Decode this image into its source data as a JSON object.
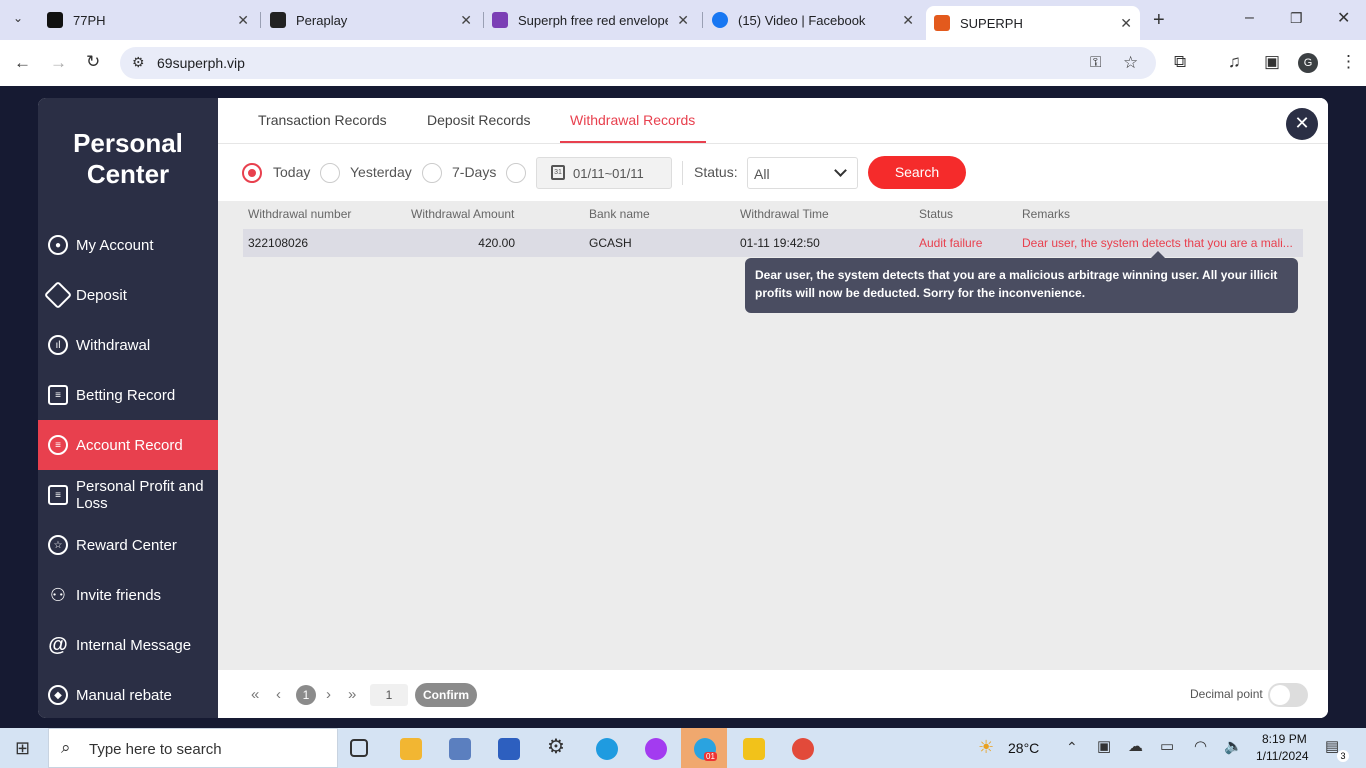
{
  "browser": {
    "tabs": [
      {
        "title": "77PH",
        "color": "#111"
      },
      {
        "title": "Peraplay",
        "color": "#222"
      },
      {
        "title": "Superph free red envelope f",
        "color": "#7b3fb5"
      },
      {
        "title": "(15) Video | Facebook",
        "color": "#1877f2"
      },
      {
        "title": "SUPERPH",
        "color": "#e35a1d"
      }
    ],
    "url": "69superph.vip"
  },
  "sidebar": {
    "title": "Personal Center",
    "items": [
      {
        "label": "My Account",
        "icon": "user-icon"
      },
      {
        "label": "Deposit",
        "icon": "tag-icon"
      },
      {
        "label": "Withdrawal",
        "icon": "chart-icon"
      },
      {
        "label": "Betting Record",
        "icon": "clipboard-icon"
      },
      {
        "label": "Account Record",
        "icon": "list-icon"
      },
      {
        "label": "Personal Profit and Loss",
        "icon": "document-icon"
      },
      {
        "label": "Reward Center",
        "icon": "star-icon"
      },
      {
        "label": "Invite friends",
        "icon": "people-icon"
      },
      {
        "label": "Internal Message",
        "icon": "at-icon"
      },
      {
        "label": "Manual rebate",
        "icon": "rebate-icon"
      }
    ],
    "active": "Account Record"
  },
  "record_tabs": [
    "Transaction Records",
    "Deposit Records",
    "Withdrawal Records"
  ],
  "active_tab": "Withdrawal Records",
  "filters": {
    "periods": [
      "Today",
      "Yesterday",
      "7-Days"
    ],
    "selected_period": "Today",
    "date_range": "01/11~01/11",
    "status_label": "Status",
    "status_value": "All",
    "search_label": "Search"
  },
  "table": {
    "headers": [
      "Withdrawal number",
      "Withdrawal Amount",
      "Bank name",
      "Withdrawal Time",
      "Status",
      "Remarks"
    ],
    "rows": [
      {
        "number": "322108026",
        "amount": "420.00",
        "bank": "GCASH",
        "time": "01-11 19:42:50",
        "status": "Audit failure",
        "remarks": "Dear user, the system detects that you are a mali..."
      }
    ]
  },
  "tooltip": "Dear user, the system detects that you are a malicious arbitrage winning user. All your illicit profits will now be deducted. Sorry for the inconvenience.",
  "pagination": {
    "current": "1",
    "input": "1",
    "confirm": "Confirm"
  },
  "decimal_point_label": "Decimal point",
  "taskbar": {
    "search_placeholder": "Type here to search",
    "weather": "28°C",
    "time": "8:19 PM",
    "date": "1/11/2024",
    "notification_count": "3",
    "telegram_badge": "01"
  }
}
